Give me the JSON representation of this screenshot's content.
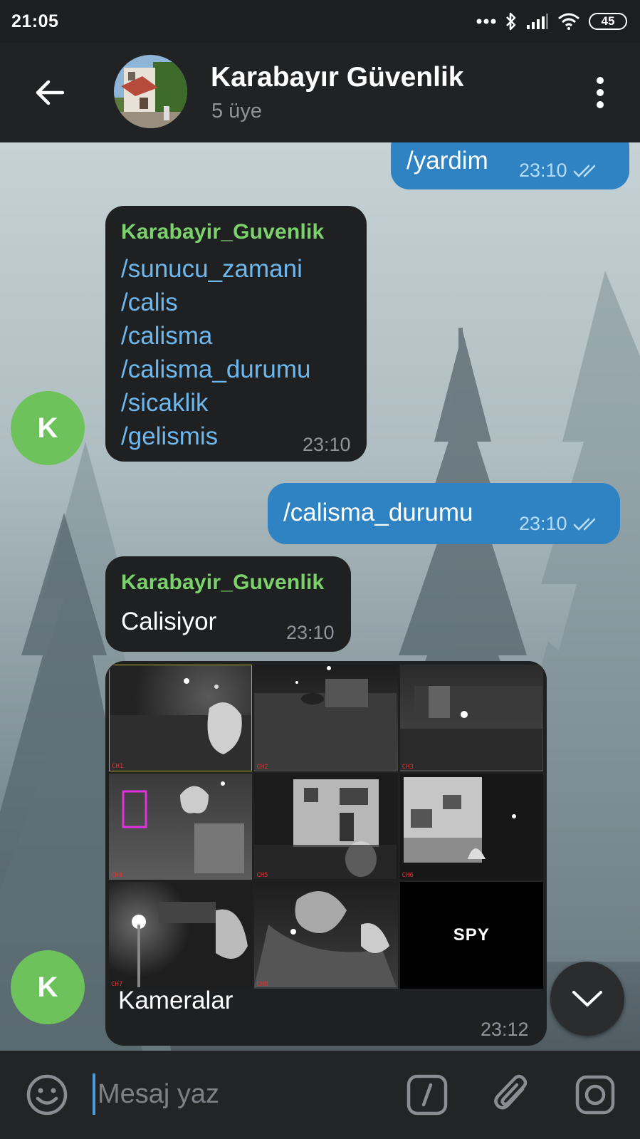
{
  "status_bar": {
    "time": "21:05",
    "battery": "45",
    "icons": [
      "more-dots-icon",
      "bluetooth-icon",
      "signal-icon",
      "wifi-icon",
      "battery-icon"
    ]
  },
  "header": {
    "title": "Karabayır Güvenlik",
    "subtitle": "5 üye"
  },
  "messages": [
    {
      "type": "outgoing",
      "text": "/yardim",
      "time": "23:10",
      "status": "read"
    },
    {
      "type": "incoming",
      "sender": "Karabayir_Guvenlik",
      "commands": [
        "/sunucu_zamani",
        "/calis",
        "/calisma",
        "/calisma_durumu",
        "/sicaklik",
        "/gelismis"
      ],
      "time": "23:10",
      "avatar_letter": "K"
    },
    {
      "type": "outgoing",
      "text": "/calisma_durumu",
      "time": "23:10",
      "status": "read"
    },
    {
      "type": "incoming",
      "sender": "Karabayir_Guvenlik",
      "text": "Calisiyor",
      "time": "23:10"
    },
    {
      "type": "incoming-photo",
      "caption": "Kameralar",
      "time": "23:12",
      "avatar_letter": "K",
      "grid_logo": "SPY"
    }
  ],
  "input": {
    "placeholder": "Mesaj yaz"
  },
  "colors": {
    "outgoing_bubble": "#2f83c2",
    "incoming_bubble": "#1f2022",
    "sender_name": "#7bd26a",
    "command_link": "#6cb8ef",
    "avatar": "#6ec25b"
  }
}
